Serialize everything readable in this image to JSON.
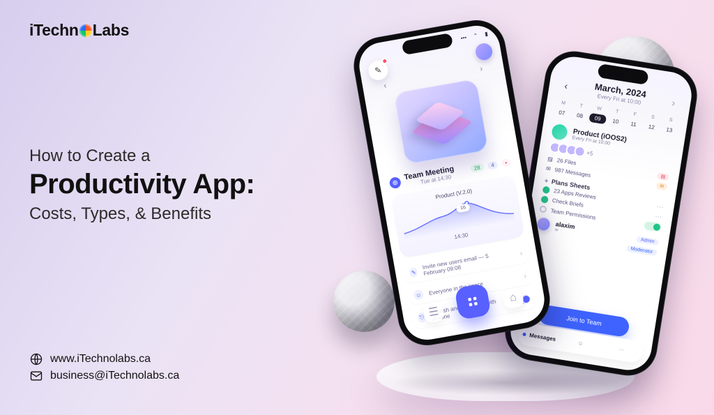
{
  "brand": {
    "name_prefix": "iTechn",
    "name_suffix": "Labs"
  },
  "headline": {
    "pre": "How to Create a",
    "main": "Productivity App:",
    "sub": "Costs, Types, & Benefits"
  },
  "contact": {
    "website": "www.iTechnolabs.ca",
    "email": "business@iTechnolabs.ca"
  },
  "phone_left": {
    "status": {
      "signal": "•••",
      "wifi": "⌃",
      "battery": "▮"
    },
    "team_meeting": {
      "title": "Team Meeting",
      "subtitle": "Tue at 14:30",
      "chips": {
        "green": "28",
        "blue": "4",
        "red": "•"
      }
    },
    "chart": {
      "legend": "Product (V.2.0)",
      "peak_label": "16",
      "time_label": "14:30"
    },
    "mini_rows": {
      "r1": "Invite new users email — 5 February 09:08",
      "r2": "Everyone in the space",
      "r3": "Publish and share link with anyone"
    },
    "nav": {
      "left_glyph": "‹",
      "right_glyph": "›"
    }
  },
  "phone_right": {
    "header": {
      "title": "March, 2024",
      "subtitle": "Every Fri at 10:00"
    },
    "weekdays": [
      "M",
      "T",
      "W",
      "T",
      "F",
      "S",
      "S"
    ],
    "dates": [
      "07",
      "08",
      "09",
      "10",
      "11",
      "12",
      "13"
    ],
    "selected_index": 2,
    "product": {
      "name": "Product (iOOS2)",
      "sub": "Every Fri at 10:00"
    },
    "avatars_more": "+5",
    "stats": {
      "files": "26 Files",
      "messages": "987 Messages"
    },
    "section_title": "Plans Sheets",
    "tasks": {
      "t1": "23 Apps Reviews",
      "t2": "Check Briefs",
      "t3": "Team Permissions"
    },
    "member": {
      "name": "alaxim",
      "role": "Admin",
      "sub_role": "Moderator",
      "below": "w"
    },
    "cta": "Join to Team",
    "tabs": {
      "messages": "Messages"
    }
  }
}
